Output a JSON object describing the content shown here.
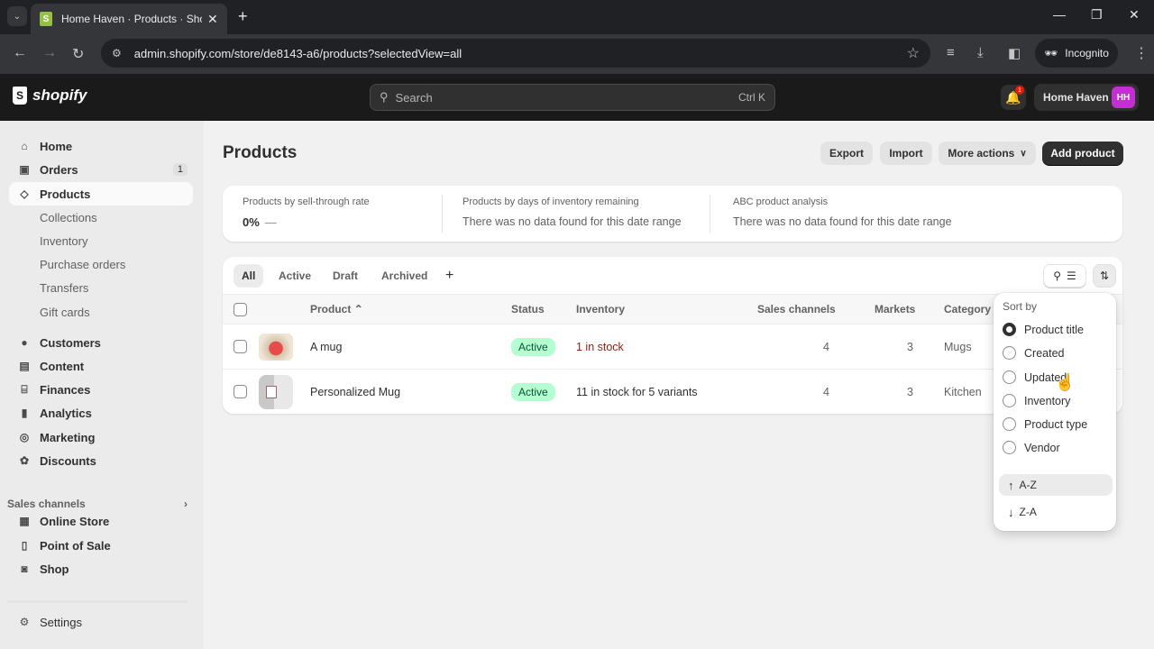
{
  "browser": {
    "tab_title": "Home Haven · Products · Shopify",
    "tab_favicon": "shopify-bag-icon",
    "url": "admin.shopify.com/store/de8143-a6/products?selectedView=all",
    "incognito_label": "Incognito",
    "icons": [
      "back-icon",
      "forward-icon",
      "reload-icon",
      "site-info-icon",
      "star-icon",
      "reading-list-icon",
      "download-icon",
      "side-panel-icon",
      "incognito-icon",
      "menu-icon"
    ]
  },
  "topbar": {
    "logo_text": "shopify",
    "search_placeholder": "Search",
    "search_shortcut": "Ctrl K",
    "notification_count": "1",
    "store_name": "Home Haven",
    "avatar_initials": "HH",
    "avatar_color": "#c52ed5"
  },
  "sidebar": {
    "items": [
      {
        "label": "Home",
        "icon": "home-icon"
      },
      {
        "label": "Orders",
        "icon": "inbox-icon",
        "count": "1"
      },
      {
        "label": "Products",
        "icon": "tag-icon",
        "active": true
      }
    ],
    "product_subitems": [
      "Collections",
      "Inventory",
      "Purchase orders",
      "Transfers",
      "Gift cards"
    ],
    "items2": [
      {
        "label": "Customers",
        "icon": "person-icon"
      },
      {
        "label": "Content",
        "icon": "image-icon"
      },
      {
        "label": "Finances",
        "icon": "bank-icon"
      },
      {
        "label": "Analytics",
        "icon": "bar-chart-icon"
      },
      {
        "label": "Marketing",
        "icon": "target-icon"
      },
      {
        "label": "Discounts",
        "icon": "discount-icon"
      }
    ],
    "sales_channels_label": "Sales channels",
    "channels": [
      {
        "label": "Online Store",
        "icon": "store-icon"
      },
      {
        "label": "Point of Sale",
        "icon": "pos-icon"
      },
      {
        "label": "Shop",
        "icon": "shop-icon"
      }
    ],
    "settings_label": "Settings"
  },
  "page": {
    "title": "Products",
    "actions": {
      "export": "Export",
      "import": "Import",
      "more_actions": "More actions",
      "add_product": "Add product"
    }
  },
  "analytics": [
    {
      "label": "Products by sell-through rate",
      "value": "0%",
      "trend": "—"
    },
    {
      "label": "Products by days of inventory remaining",
      "value": "There was no data found for this date range"
    },
    {
      "label": "ABC product analysis",
      "value": "There was no data found for this date range"
    }
  ],
  "views": [
    "All",
    "Active",
    "Draft",
    "Archived"
  ],
  "selected_view": "All",
  "table": {
    "columns": [
      "Product",
      "Status",
      "Inventory",
      "Sales channels",
      "Markets",
      "Category"
    ],
    "rows": [
      {
        "product": "A mug",
        "status": "Active",
        "inventory": "1 in stock",
        "inventory_low": true,
        "sales_channels": "4",
        "markets": "3",
        "category": "Mugs"
      },
      {
        "product": "Personalized Mug",
        "status": "Active",
        "inventory": "11 in stock for 5 variants",
        "inventory_low": false,
        "sales_channels": "4",
        "markets": "3",
        "category": "Kitchen"
      }
    ]
  },
  "sort_popover": {
    "header": "Sort by",
    "options": [
      "Product title",
      "Created",
      "Updated",
      "Inventory",
      "Product type",
      "Vendor"
    ],
    "selected_option": "Product title",
    "directions": [
      {
        "label": "A-Z",
        "icon": "arrow-up-icon"
      },
      {
        "label": "Z-A",
        "icon": "arrow-down-icon"
      }
    ],
    "selected_direction": "A-Z"
  },
  "colors": {
    "active_badge_bg": "#b4fed2",
    "active_badge_text": "#0c5132",
    "low_stock_text": "#8e1f0b",
    "primary_button": "#303030"
  }
}
